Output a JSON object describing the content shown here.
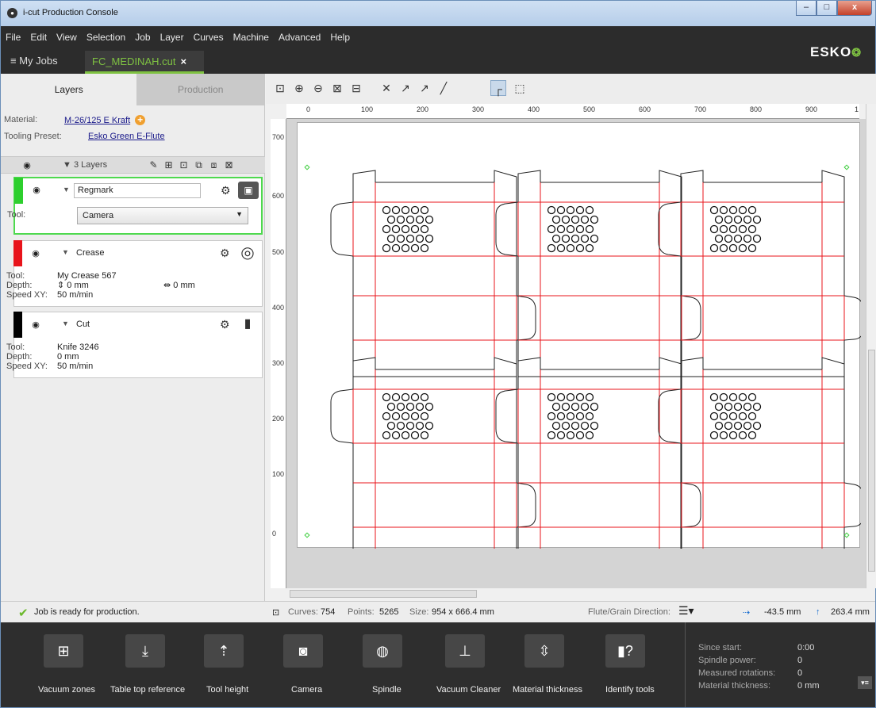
{
  "window": {
    "title": "i-cut Production Console",
    "minimize": "–",
    "maximize": "□",
    "close": "x"
  },
  "menu": [
    "File",
    "Edit",
    "View",
    "Selection",
    "Job",
    "Layer",
    "Curves",
    "Machine",
    "Advanced",
    "Help"
  ],
  "brand": "ESKO",
  "tabs": {
    "my_jobs": "My Jobs",
    "job": "FC_MEDINAH.cut",
    "close": "×"
  },
  "left_tabs": {
    "layers": "Layers",
    "production": "Production"
  },
  "material": {
    "label": "Material:",
    "value": "M-26/125 E Kraft"
  },
  "tooling": {
    "label": "Tooling Preset:",
    "value": "Esko Green E-Flute"
  },
  "layers_header": {
    "count": "3 Layers"
  },
  "layers": [
    {
      "name": "Regmark",
      "color": "#2dcf2d",
      "tool_label": "Tool:",
      "tool": "Camera"
    },
    {
      "name": "Crease",
      "color": "#e8141b",
      "tool_label": "Tool:",
      "tool": "My Crease 567",
      "depth_label": "Depth:",
      "depth": "0 mm",
      "width": "0 mm",
      "speed_label": "Speed XY:",
      "speed": "50 m/min"
    },
    {
      "name": "Cut",
      "color": "#000000",
      "tool_label": "Tool:",
      "tool": "Knife 3246",
      "depth_label": "Depth:",
      "depth": "0 mm",
      "speed_label": "Speed XY:",
      "speed": "50 m/min"
    }
  ],
  "rulers": {
    "h": [
      "0",
      "100",
      "200",
      "300",
      "400",
      "500",
      "600",
      "700",
      "800",
      "900",
      "1"
    ],
    "v": [
      "700",
      "600",
      "500",
      "400",
      "300",
      "200",
      "100",
      "0"
    ]
  },
  "status": {
    "ready": "Job is ready for production.",
    "curves_label": "Curves:",
    "curves": "754",
    "points_label": "Points:",
    "points": "5265",
    "size_label": "Size:",
    "size": "954 x 666.4 mm",
    "flute_label": "Flute/Grain Direction:",
    "x": "-43.5 mm",
    "y": "263.4 mm"
  },
  "actions": [
    "Vacuum zones",
    "Table top reference",
    "Tool height",
    "Camera",
    "Spindle",
    "Vacuum Cleaner",
    "Material thickness",
    "Identify tools"
  ],
  "stats": [
    {
      "label": "Since start:",
      "value": "0:00"
    },
    {
      "label": "Spindle power:",
      "value": "0"
    },
    {
      "label": "Measured rotations:",
      "value": "0"
    },
    {
      "label": "Material thickness:",
      "value": "0 mm"
    }
  ]
}
